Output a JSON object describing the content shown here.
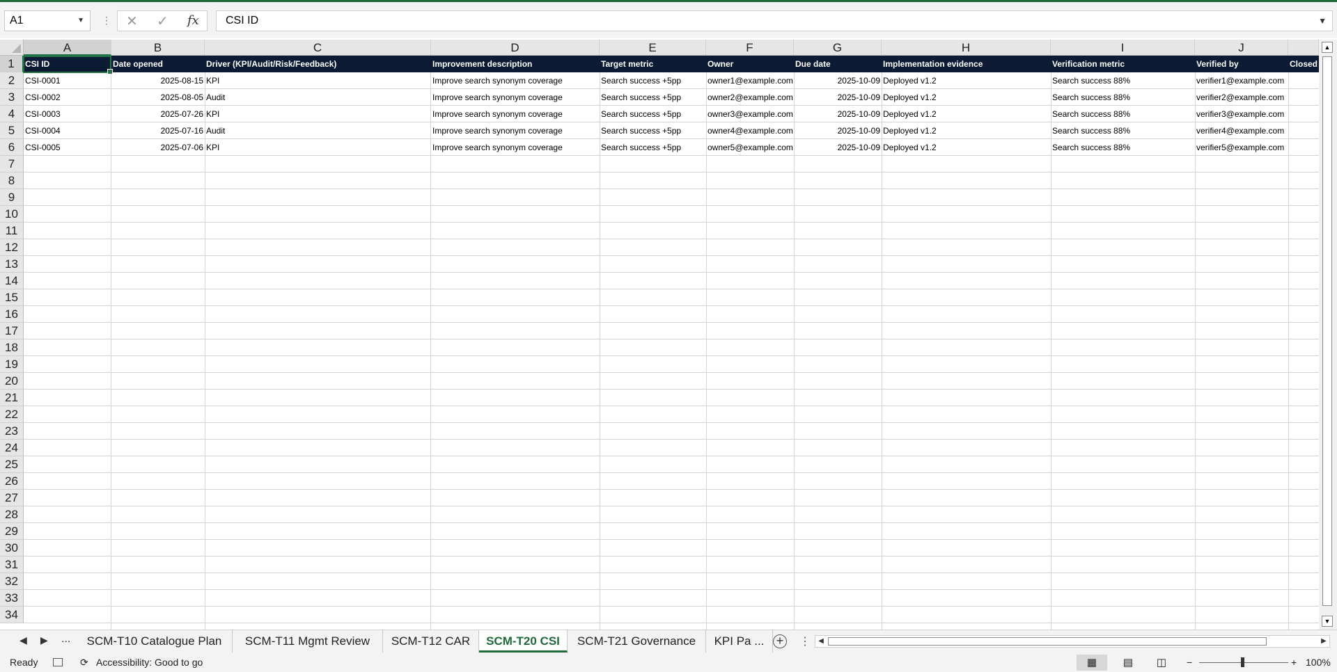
{
  "formula_bar": {
    "name_box": "A1",
    "formula": "CSI ID"
  },
  "columns": [
    "A",
    "B",
    "C",
    "D",
    "E",
    "F",
    "G",
    "H",
    "I",
    "J"
  ],
  "rows": [
    "1",
    "2",
    "3",
    "4",
    "5",
    "6",
    "7",
    "8",
    "9",
    "10",
    "11",
    "12",
    "13",
    "14",
    "15",
    "16",
    "17",
    "18",
    "19",
    "20",
    "21",
    "22",
    "23",
    "24",
    "25",
    "26",
    "27",
    "28",
    "29",
    "30",
    "31",
    "32",
    "33",
    "34"
  ],
  "table": {
    "headers": [
      "CSI ID",
      "Date opened",
      "Driver (KPI/Audit/Risk/Feedback)",
      "Improvement description",
      "Target metric",
      "Owner",
      "Due date",
      "Implementation evidence",
      "Verification metric",
      "Verified by",
      "Closed"
    ],
    "rows": [
      [
        "CSI-0001",
        "2025-08-15",
        "KPI",
        "Improve search synonym coverage",
        "Search success +5pp",
        "owner1@example.com",
        "2025-10-09",
        "Deployed v1.2",
        "Search success 88%",
        "verifier1@example.com"
      ],
      [
        "CSI-0002",
        "2025-08-05",
        "Audit",
        "Improve search synonym coverage",
        "Search success +5pp",
        "owner2@example.com",
        "2025-10-09",
        "Deployed v1.2",
        "Search success 88%",
        "verifier2@example.com"
      ],
      [
        "CSI-0003",
        "2025-07-26",
        "KPI",
        "Improve search synonym coverage",
        "Search success +5pp",
        "owner3@example.com",
        "2025-10-09",
        "Deployed v1.2",
        "Search success 88%",
        "verifier3@example.com"
      ],
      [
        "CSI-0004",
        "2025-07-16",
        "Audit",
        "Improve search synonym coverage",
        "Search success +5pp",
        "owner4@example.com",
        "2025-10-09",
        "Deployed v1.2",
        "Search success 88%",
        "verifier4@example.com"
      ],
      [
        "CSI-0005",
        "2025-07-06",
        "KPI",
        "Improve search synonym coverage",
        "Search success +5pp",
        "owner5@example.com",
        "2025-10-09",
        "Deployed v1.2",
        "Search success 88%",
        "verifier5@example.com"
      ]
    ]
  },
  "sheet_tabs": {
    "ellipsis": "...",
    "tabs": [
      "SCM-T10 Catalogue Plan",
      "SCM-T11 Mgmt Review",
      "SCM-T12 CAR",
      "SCM-T20 CSI",
      "SCM-T21 Governance",
      "KPI Pa ..."
    ],
    "active_index": 3
  },
  "status_bar": {
    "ready": "Ready",
    "accessibility": "Accessibility: Good to go",
    "zoom": "100%"
  },
  "colors": {
    "accent": "#217346",
    "header_fill": "#0c1a33"
  }
}
